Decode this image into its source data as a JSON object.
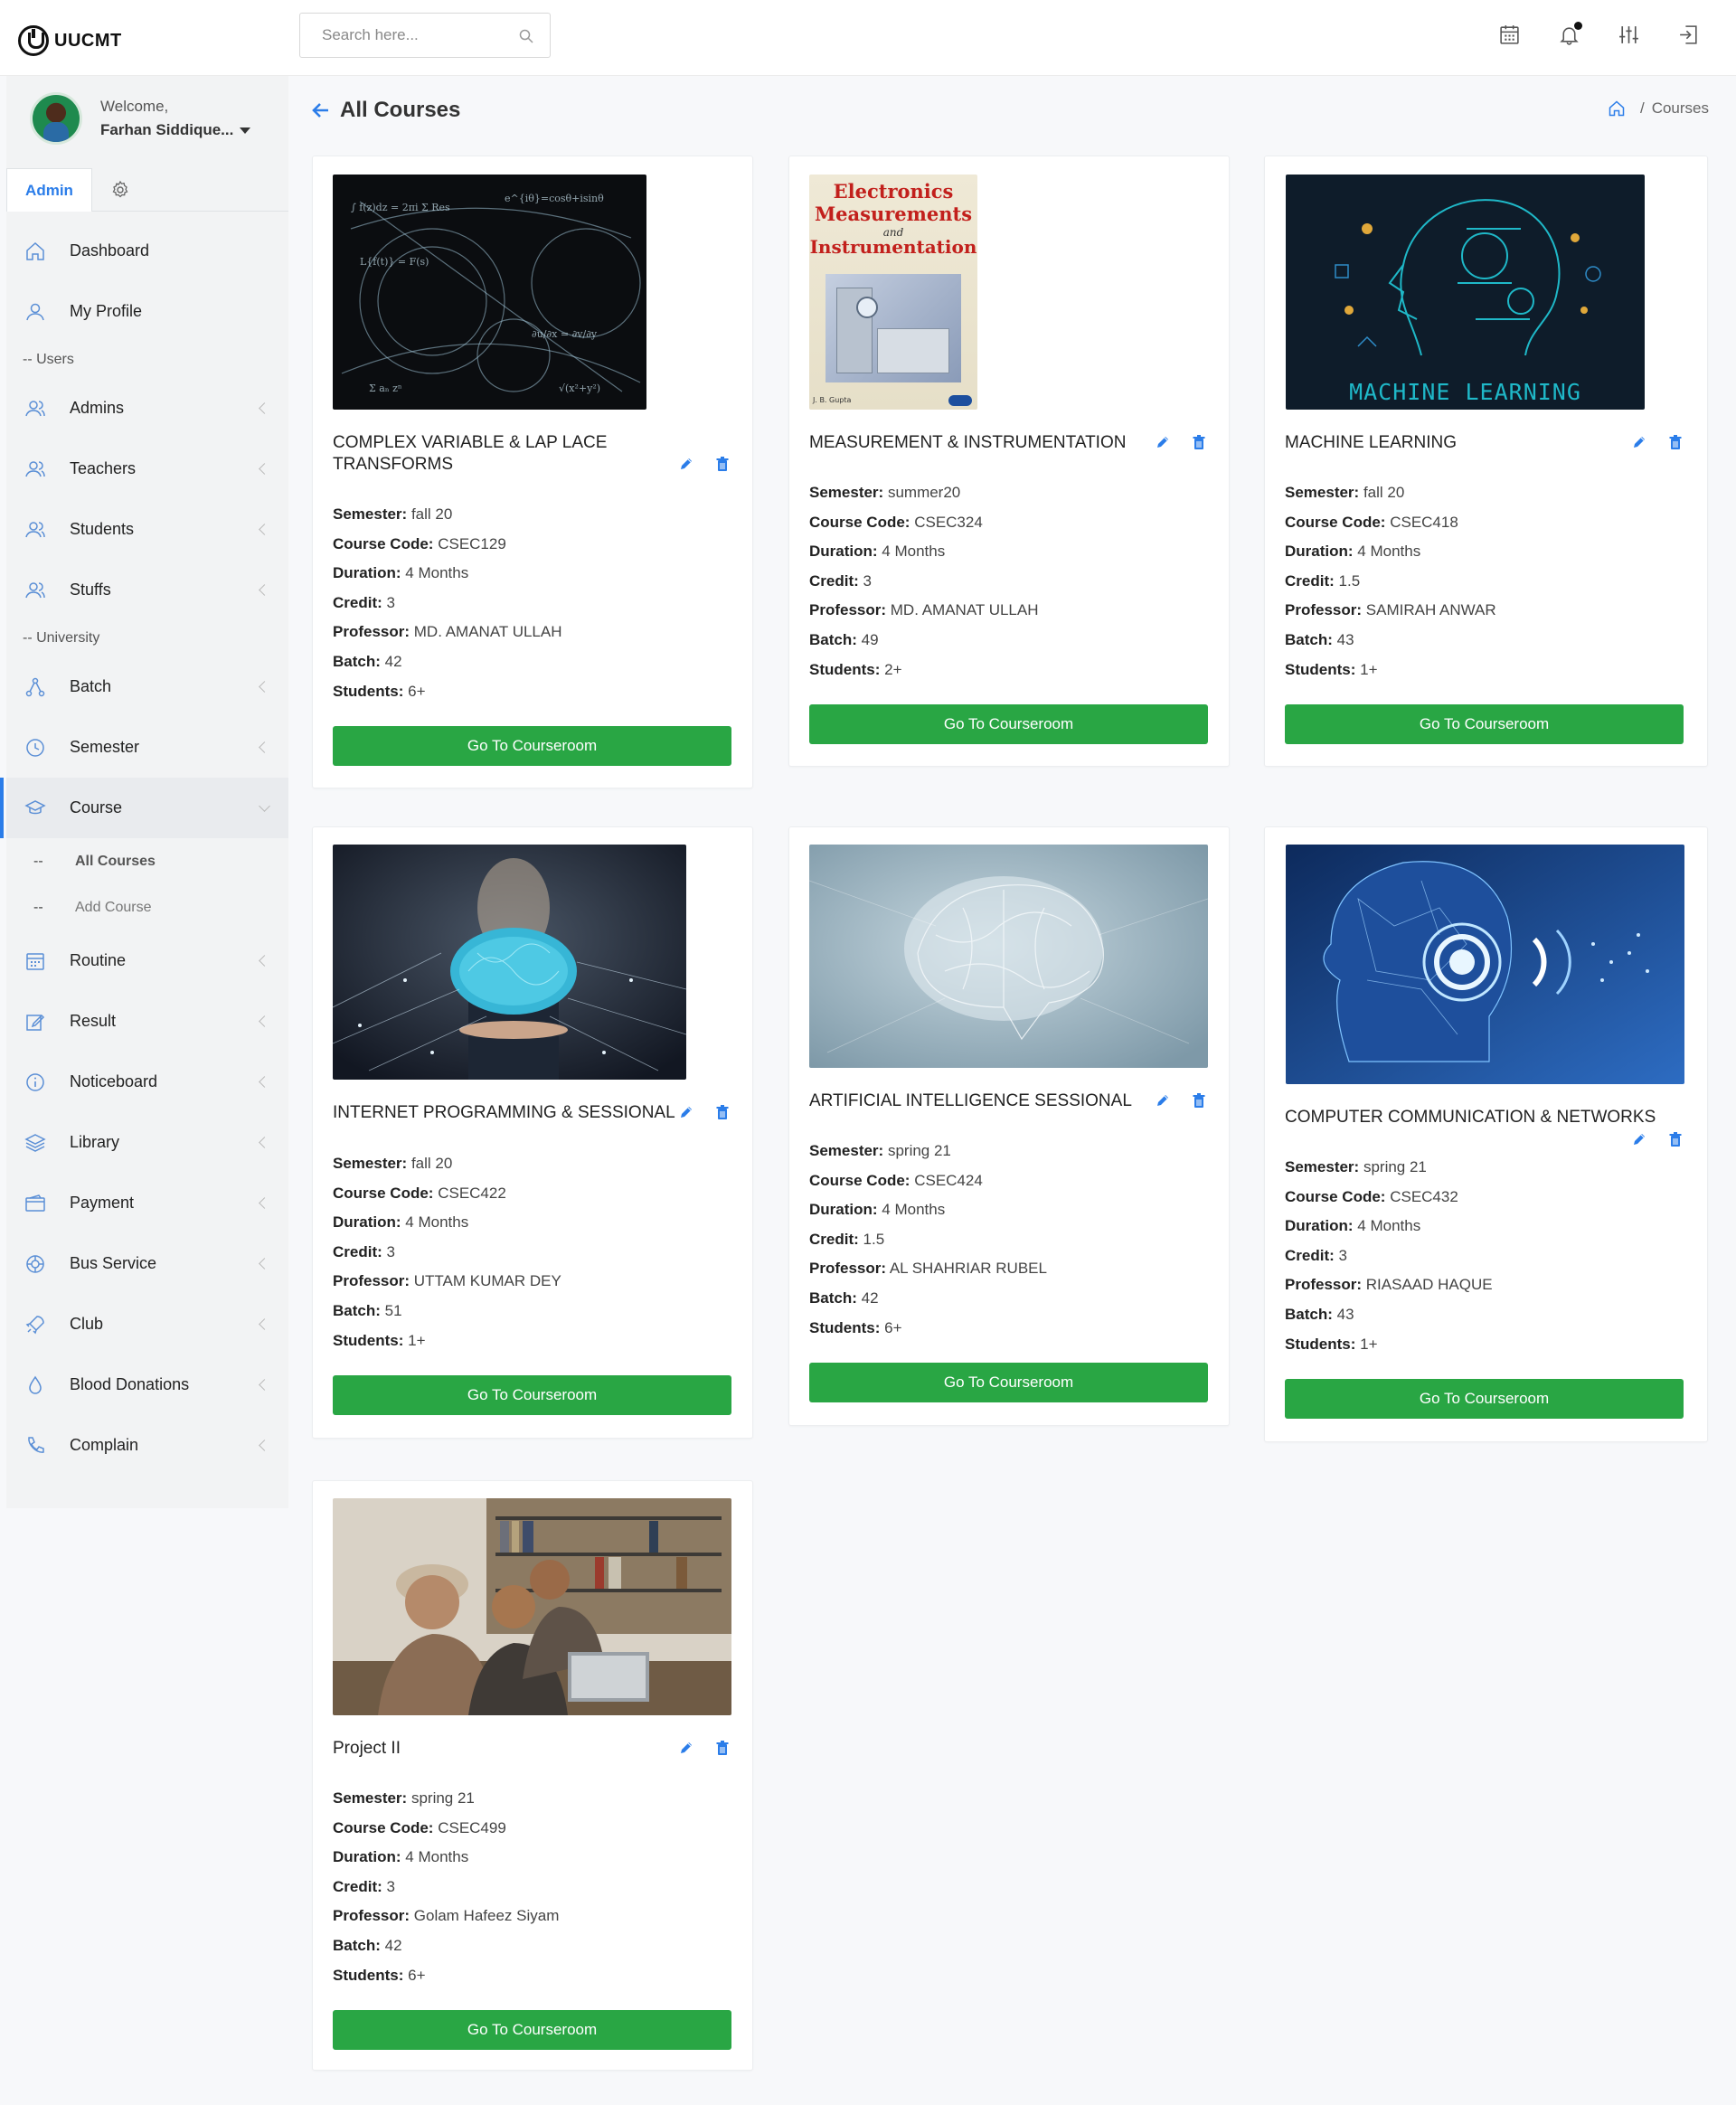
{
  "brand": {
    "name": "UUCMT"
  },
  "header": {
    "search_placeholder": "Search here...",
    "icons": [
      "calendar-icon",
      "bell-icon",
      "sliders-icon",
      "logout-icon"
    ]
  },
  "user": {
    "welcome": "Welcome,",
    "name": "Farhan Siddique..."
  },
  "sidebar": {
    "tab_admin": "Admin",
    "items": {
      "dashboard": "Dashboard",
      "my_profile": "My Profile",
      "section_users": "-- Users",
      "admins": "Admins",
      "teachers": "Teachers",
      "students": "Students",
      "stuffs": "Stuffs",
      "section_university": "-- University",
      "batch": "Batch",
      "semester": "Semester",
      "course": "Course",
      "all_courses": "All Courses",
      "add_course": "Add Course",
      "sub_dash": "--",
      "routine": "Routine",
      "result": "Result",
      "noticeboard": "Noticeboard",
      "library": "Library",
      "payment": "Payment",
      "bus_service": "Bus Service",
      "club": "Club",
      "blood_donations": "Blood Donations",
      "complain": "Complain"
    }
  },
  "page": {
    "title": "All Courses",
    "breadcrumb_current": "Courses",
    "breadcrumb_sep": "/"
  },
  "labels": {
    "semester": "Semester:",
    "course_code": "Course Code:",
    "duration": "Duration:",
    "credit": "Credit:",
    "professor": "Professor:",
    "batch": "Batch:",
    "students": "Students:",
    "button": "Go To Courseroom"
  },
  "courses": [
    {
      "title": "COMPLEX VARIABLE & LAP LACE TRANSFORMS",
      "semester": "fall 20",
      "code": "CSEC129",
      "duration": "4 Months",
      "credit": "3",
      "professor": "MD. AMANAT ULLAH",
      "batch": "42",
      "students": "6+"
    },
    {
      "title": "MEASUREMENT & INSTRUMENTATION",
      "semester": "summer20",
      "code": "CSEC324",
      "duration": "4 Months",
      "credit": "3",
      "professor": "MD. AMANAT ULLAH",
      "batch": "49",
      "students": "2+",
      "book": {
        "line1": "Electronics",
        "line2": "Measurements",
        "line3": "and",
        "line4": "Instrumentation",
        "author": "J. B. Gupta"
      }
    },
    {
      "title": "MACHINE LEARNING",
      "semester": "fall 20",
      "code": "CSEC418",
      "duration": "4 Months",
      "credit": "1.5",
      "professor": "SAMIRAH ANWAR",
      "batch": "43",
      "students": "1+",
      "image_caption": "MACHINE LEARNING"
    },
    {
      "title": "INTERNET PROGRAMMING & SESSIONAL",
      "semester": "fall 20",
      "code": "CSEC422",
      "duration": "4 Months",
      "credit": "3",
      "professor": "UTTAM KUMAR DEY",
      "batch": "51",
      "students": "1+"
    },
    {
      "title": "ARTIFICIAL INTELLIGENCE SESSIONAL",
      "semester": "spring 21",
      "code": "CSEC424",
      "duration": "4 Months",
      "credit": "1.5",
      "professor": "AL SHAHRIAR RUBEL",
      "batch": "42",
      "students": "6+"
    },
    {
      "title": "COMPUTER COMMUNICATION & NETWORKS",
      "semester": "spring 21",
      "code": "CSEC432",
      "duration": "4 Months",
      "credit": "3",
      "professor": "RIASAAD HAQUE",
      "batch": "43",
      "students": "1+"
    },
    {
      "title": "Project II",
      "semester": "spring 21",
      "code": "CSEC499",
      "duration": "4 Months",
      "credit": "3",
      "professor": "Golam Hafeez Siyam",
      "batch": "42",
      "students": "6+"
    }
  ],
  "colors": {
    "accent": "#2b7de9",
    "button": "#29a644"
  }
}
